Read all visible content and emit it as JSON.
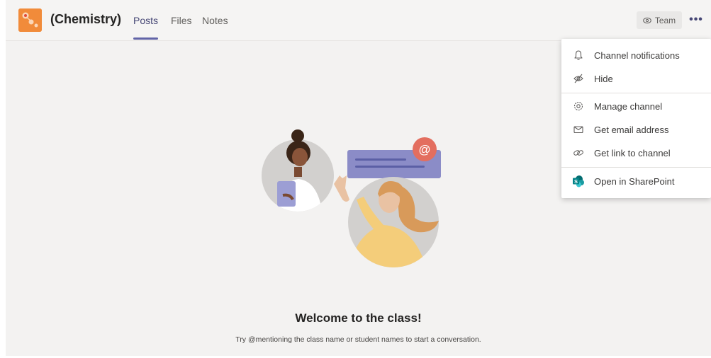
{
  "header": {
    "team_name": "(Chemistry)",
    "tabs": [
      {
        "label": "Posts",
        "active": true
      },
      {
        "label": "Files",
        "active": false
      },
      {
        "label": "Notes",
        "active": false
      }
    ],
    "team_button_label": "Team",
    "more_label": "•••"
  },
  "menu": {
    "items": [
      {
        "label": "Channel notifications",
        "icon": "bell-icon"
      },
      {
        "label": "Hide",
        "icon": "eye-slash-icon"
      },
      {
        "label": "Manage channel",
        "icon": "gear-icon"
      },
      {
        "label": "Get email address",
        "icon": "envelope-icon"
      },
      {
        "label": "Get link to channel",
        "icon": "link-icon"
      },
      {
        "label": "Open in SharePoint",
        "icon": "sharepoint-icon"
      }
    ]
  },
  "welcome": {
    "title": "Welcome to the class!",
    "subtitle": "Try @mentioning the class name or student names to start a conversation.",
    "mention_symbol": "@"
  },
  "colors": {
    "accent": "#6264a7",
    "team_logo": "#f18b3a",
    "mention_badge": "#e36e5f",
    "sharepoint": "#038387"
  }
}
